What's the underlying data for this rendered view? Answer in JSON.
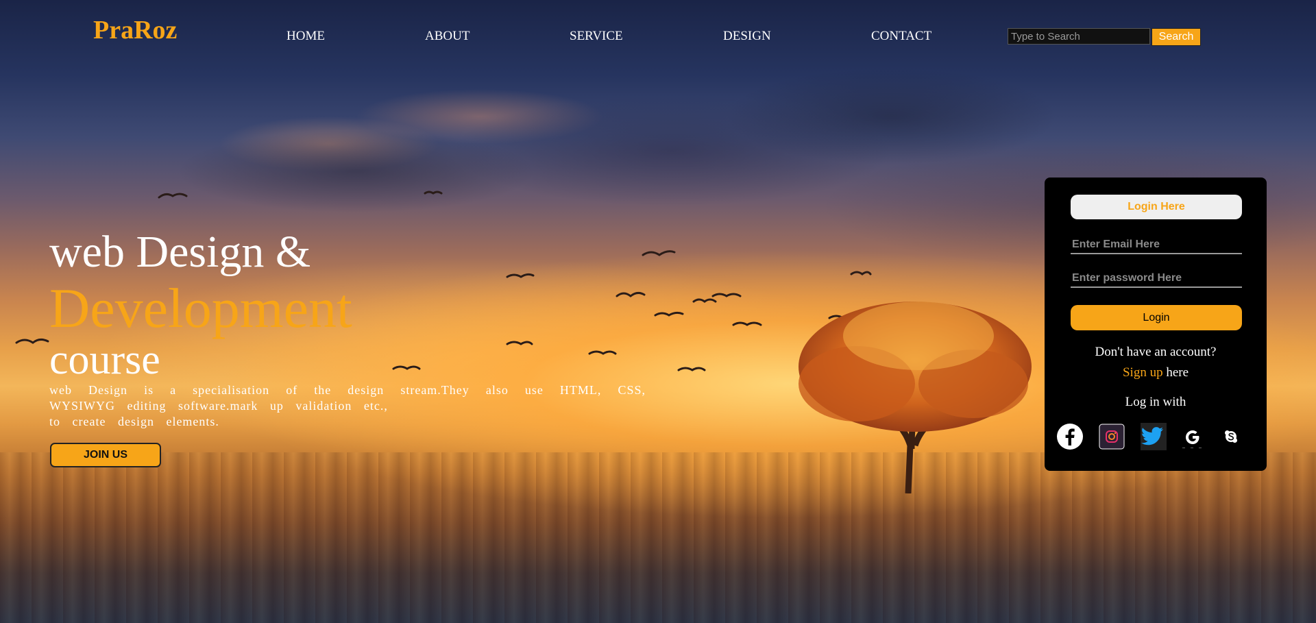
{
  "brand": {
    "logo": "PraRoz",
    "accent_color": "#f7a518"
  },
  "nav": {
    "items": [
      {
        "label": "HOME"
      },
      {
        "label": "ABOUT"
      },
      {
        "label": "SERVICE"
      },
      {
        "label": "DESIGN"
      },
      {
        "label": "CONTACT"
      }
    ]
  },
  "search": {
    "placeholder": "Type to Search",
    "button_label": "Search"
  },
  "hero": {
    "line1": "web Design &",
    "line2": "Development",
    "line3": "course",
    "description_l1": "web Design is a specialisation of the design stream.They also use HTML, CSS, WYSIWYG editing software.mark up validation etc.,",
    "description_l2": "to create design elements.",
    "cta_label": "JOIN US"
  },
  "login": {
    "title": "Login Here",
    "email_placeholder": "Enter Email Here",
    "password_placeholder": "Enter password Here",
    "submit_label": "Login",
    "no_account": "Don't have an account?",
    "signup_link": "Sign up",
    "signup_suffix": " here",
    "social_heading": "Log in with",
    "social": [
      {
        "icon": "facebook-icon"
      },
      {
        "icon": "instagram-icon"
      },
      {
        "icon": "twitter-icon"
      },
      {
        "icon": "google-icon"
      },
      {
        "icon": "skype-icon"
      }
    ]
  }
}
